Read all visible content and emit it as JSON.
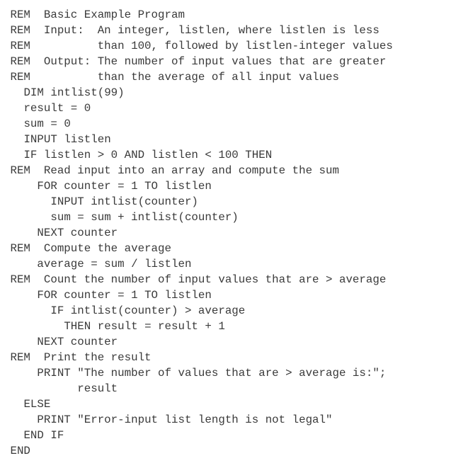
{
  "code_lines": [
    {
      "indent": 1,
      "text": "REM  Basic Example Program"
    },
    {
      "indent": 1,
      "text": "REM  Input:  An integer, listlen, where listlen is less"
    },
    {
      "indent": 1,
      "text": "REM          than 100, followed by listlen-integer values"
    },
    {
      "indent": 1,
      "text": "REM  Output: The number of input values that are greater"
    },
    {
      "indent": 1,
      "text": "REM          than the average of all input values"
    },
    {
      "indent": 3,
      "text": "DIM intlist(99)"
    },
    {
      "indent": 3,
      "text": "result = 0"
    },
    {
      "indent": 3,
      "text": "sum = 0"
    },
    {
      "indent": 3,
      "text": "INPUT listlen"
    },
    {
      "indent": 3,
      "text": "IF listlen > 0 AND listlen < 100 THEN"
    },
    {
      "indent": 1,
      "text": "REM  Read input into an array and compute the sum"
    },
    {
      "indent": 5,
      "text": "FOR counter = 1 TO listlen"
    },
    {
      "indent": 7,
      "text": "INPUT intlist(counter)"
    },
    {
      "indent": 7,
      "text": "sum = sum + intlist(counter)"
    },
    {
      "indent": 5,
      "text": "NEXT counter"
    },
    {
      "indent": 1,
      "text": "REM  Compute the average"
    },
    {
      "indent": 5,
      "text": "average = sum / listlen"
    },
    {
      "indent": 1,
      "text": "REM  Count the number of input values that are > average"
    },
    {
      "indent": 5,
      "text": "FOR counter = 1 TO listlen"
    },
    {
      "indent": 7,
      "text": "IF intlist(counter) > average"
    },
    {
      "indent": 9,
      "text": "THEN result = result + 1"
    },
    {
      "indent": 5,
      "text": "NEXT counter"
    },
    {
      "indent": 1,
      "text": "REM  Print the result"
    },
    {
      "indent": 5,
      "text": "PRINT \"The number of values that are > average is:\";"
    },
    {
      "indent": 11,
      "text": "result"
    },
    {
      "indent": 3,
      "text": "ELSE"
    },
    {
      "indent": 5,
      "text": "PRINT \"Error-input list length is not legal\""
    },
    {
      "indent": 3,
      "text": "END IF"
    },
    {
      "indent": 1,
      "text": "END"
    }
  ]
}
